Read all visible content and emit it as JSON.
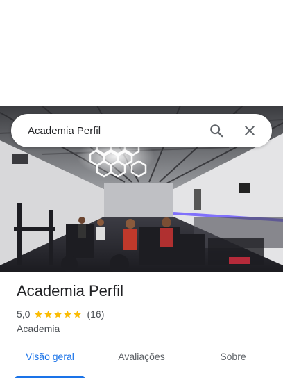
{
  "search": {
    "query": "Academia Perfil"
  },
  "place": {
    "name": "Academia Perfil",
    "rating": "5,0",
    "stars": 5,
    "review_count": "(16)",
    "category": "Academia"
  },
  "tabs": [
    {
      "label": "Visão geral",
      "selected": true
    },
    {
      "label": "Avaliações",
      "selected": false
    },
    {
      "label": "Sobre",
      "selected": false
    }
  ],
  "colors": {
    "accent": "#1a73e8",
    "star": "#fbbc04",
    "text_primary": "#202124",
    "text_secondary": "#4d5156"
  },
  "icons": {
    "search": "search-icon",
    "close": "close-icon",
    "star": "star-icon"
  }
}
